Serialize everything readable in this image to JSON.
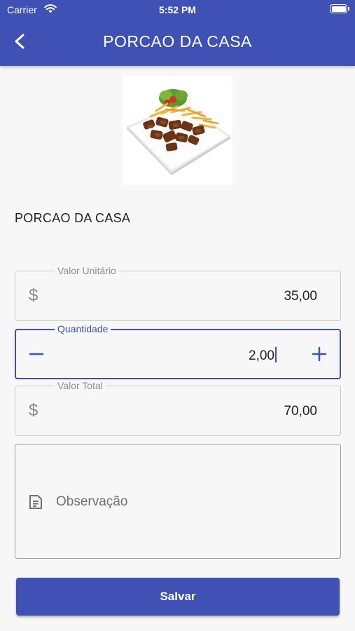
{
  "status_bar": {
    "carrier": "Carrier",
    "time": "5:52 PM"
  },
  "app_bar": {
    "title": "PORCAO DA CASA",
    "back_icon": "chevron-left-icon"
  },
  "product": {
    "name": "PORCAO DA CASA",
    "image": "meat-and-fries-dish-photo"
  },
  "fields": {
    "unit_price": {
      "label": "Valor Unitário",
      "value": "35,00",
      "icon": "dollar-icon"
    },
    "quantity": {
      "label": "Quantidade",
      "value": "2,00",
      "decrement_icon": "minus-icon",
      "increment_icon": "plus-icon"
    },
    "total": {
      "label": "Valor Total",
      "value": "70,00",
      "icon": "dollar-icon"
    },
    "observation": {
      "placeholder": "Observação",
      "icon": "note-icon"
    }
  },
  "save_button": {
    "label": "Salvar"
  },
  "colors": {
    "brand": "#3f51b5",
    "background": "#f7f7f7",
    "border": "#c9c9c9"
  }
}
